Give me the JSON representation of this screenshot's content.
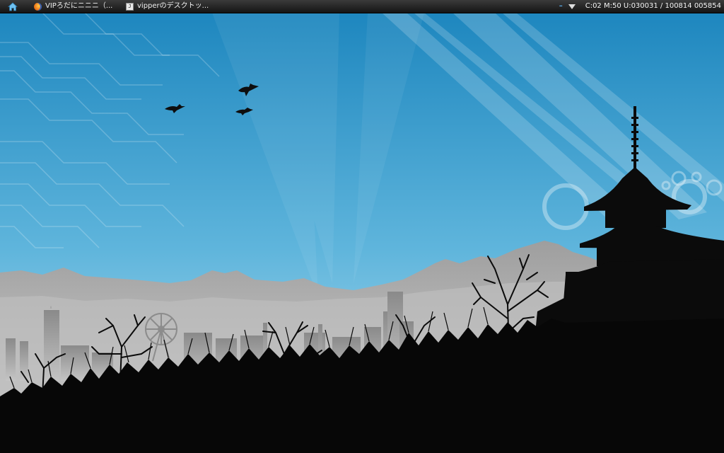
{
  "panel": {
    "home_icon": "home-icon",
    "tasks": [
      {
        "icon": "firefox-icon",
        "label": "VIPろだにニニニ（..."
      },
      {
        "icon": "terminal-icon",
        "icon_glyph": "J",
        "label": "vipperのデスクトッ..."
      }
    ],
    "tray": {
      "dash": "–",
      "network_icon": "network-icon",
      "status": "C:02 M:50 U:030031 / 100814 005854"
    }
  },
  "wallpaper": {
    "description_colors": {
      "sky_top": "#1c88c0",
      "sky_bottom": "#9fd4ea",
      "mountains": "#a9a9a9",
      "silhouette": "#000000"
    }
  }
}
